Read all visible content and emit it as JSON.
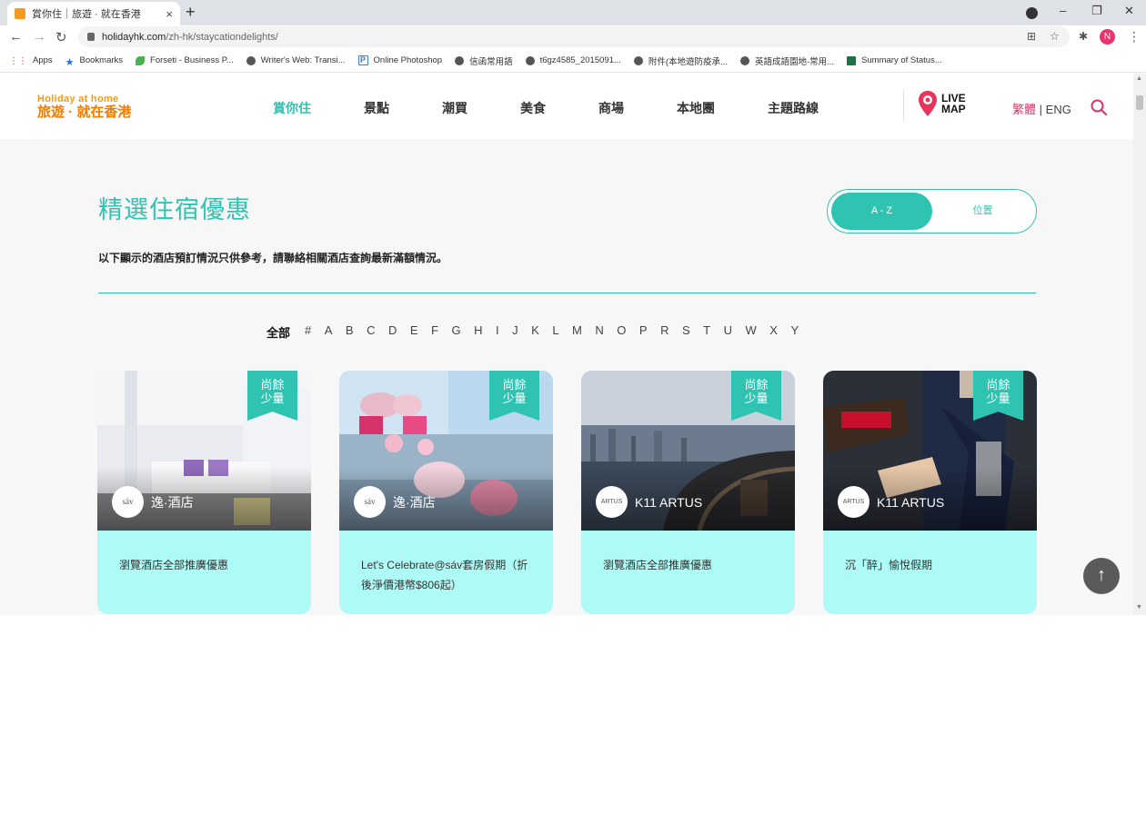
{
  "browser": {
    "tab_title": "賞你住｜旅遊 · 就在香港",
    "tab_close": "×",
    "new_tab": "+",
    "url_host": "holidayhk.com",
    "url_path": "/zh-hk/staycationdelights/",
    "profile_initial": "N",
    "bookmarks": [
      {
        "label": "Apps",
        "icon": "apps-icon"
      },
      {
        "label": "Bookmarks",
        "icon": "star-icon"
      },
      {
        "label": "Forseti - Business P...",
        "icon": "leaf-icon"
      },
      {
        "label": "Writer's Web: Transi...",
        "icon": "globe-icon"
      },
      {
        "label": "Online Photoshop",
        "icon": "photoshop-icon"
      },
      {
        "label": "信函常用語",
        "icon": "globe-icon"
      },
      {
        "label": "t6gz4585_2015091...",
        "icon": "globe-icon"
      },
      {
        "label": "附件(本地遊防疫承...",
        "icon": "globe-icon"
      },
      {
        "label": "英語成語園地-常用...",
        "icon": "globe-icon"
      },
      {
        "label": "Summary of Status...",
        "icon": "excel-icon"
      }
    ]
  },
  "header": {
    "logo_en": "Holiday at home",
    "logo_zh": "旅遊 · 就在香港",
    "nav": [
      "賞你住",
      "景點",
      "潮買",
      "美食",
      "商場",
      "本地團",
      "主題路線"
    ],
    "live_map_line1": "LIVE",
    "live_map_line2": "MAP",
    "lang_zh": "繁體",
    "lang_sep": "|",
    "lang_en": "ENG"
  },
  "main": {
    "title": "精選住宿優惠",
    "notice": "以下顯示的酒店預訂情況只供參考，請聯絡相關酒店查詢最新滿額情況。",
    "sort_az": "A - Z",
    "sort_location": "位置",
    "alphabet_all": "全部",
    "alphabet": [
      "#",
      "A",
      "B",
      "C",
      "D",
      "E",
      "F",
      "G",
      "H",
      "I",
      "J",
      "K",
      "L",
      "M",
      "N",
      "O",
      "P",
      "R",
      "S",
      "T",
      "U",
      "W",
      "X",
      "Y"
    ],
    "cards": [
      {
        "ribbon_1": "尚餘",
        "ribbon_2": "少量",
        "brand_logo": "sáv",
        "brand": "逸·酒店",
        "offer": "瀏覽酒店全部推廣優惠"
      },
      {
        "ribbon_1": "尚餘",
        "ribbon_2": "少量",
        "brand_logo": "sáv",
        "brand": "逸·酒店",
        "offer": "Let's Celebrate@sáv套房假期（折後淨價港幣$806起）"
      },
      {
        "ribbon_1": "尚餘",
        "ribbon_2": "少量",
        "brand_logo": "ARTUS",
        "brand": "K11 ARTUS",
        "offer": "瀏覽酒店全部推廣優惠"
      },
      {
        "ribbon_1": "尚餘",
        "ribbon_2": "少量",
        "brand_logo": "ARTUS",
        "brand": "K11 ARTUS",
        "offer": "沉「醉」愉悅假期"
      }
    ],
    "back_to_top": "↑"
  },
  "colors": {
    "accent": "#2fc4b2",
    "card_bg": "#aefaf6",
    "lang_active": "#e0336d",
    "logo_orange": "#f07d00"
  }
}
